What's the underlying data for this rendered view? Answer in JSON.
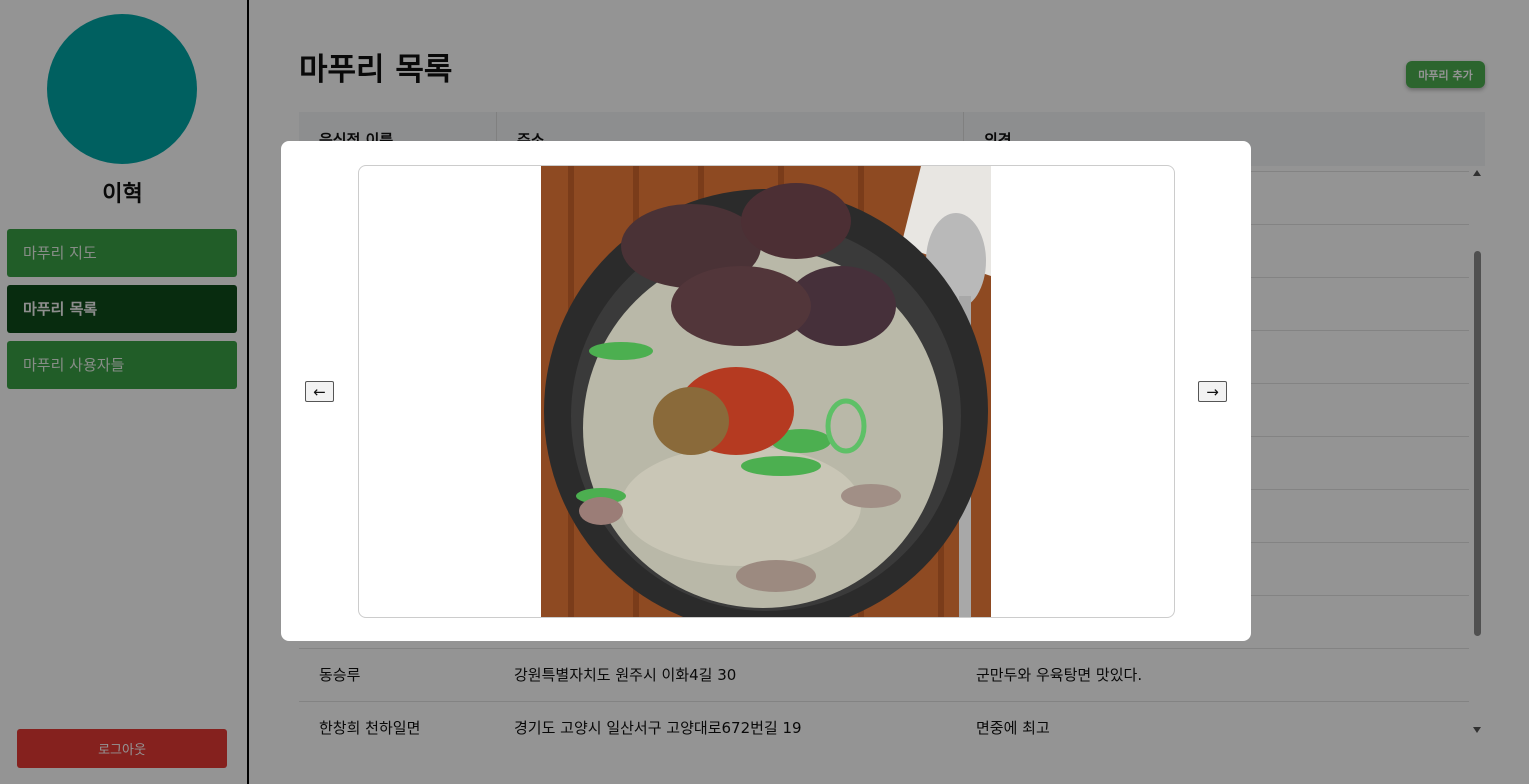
{
  "user": {
    "name": "이혁"
  },
  "nav": {
    "items": [
      {
        "label": "마푸리 지도"
      },
      {
        "label": "마푸리 목록"
      },
      {
        "label": "마푸리 사용자들"
      }
    ],
    "logout_label": "로그아웃"
  },
  "main": {
    "title": "마푸리 목록",
    "add_button_label": "마푸리 추가",
    "columns": [
      "음식점 이름",
      "주소",
      "의견"
    ],
    "rows": [
      {
        "name": "동승루",
        "address": "강원특별자치도 원주시 이화4길 30",
        "comment": "군만두와 우육탕면 맛있다."
      },
      {
        "name": "한창희 천하일면",
        "address": "경기도 고양시 일산서구 고양대로672번길 19",
        "comment": "면중에 최고"
      }
    ]
  },
  "modal": {
    "prev_label": "←",
    "next_label": "→",
    "image_icon": "food-photo-gukbap"
  },
  "colors": {
    "accent_green": "#4caf50",
    "nav_green": "#3aa046",
    "nav_active": "#0f4d1a",
    "logout_red": "#e53935",
    "avatar_teal": "#00a6a6"
  }
}
